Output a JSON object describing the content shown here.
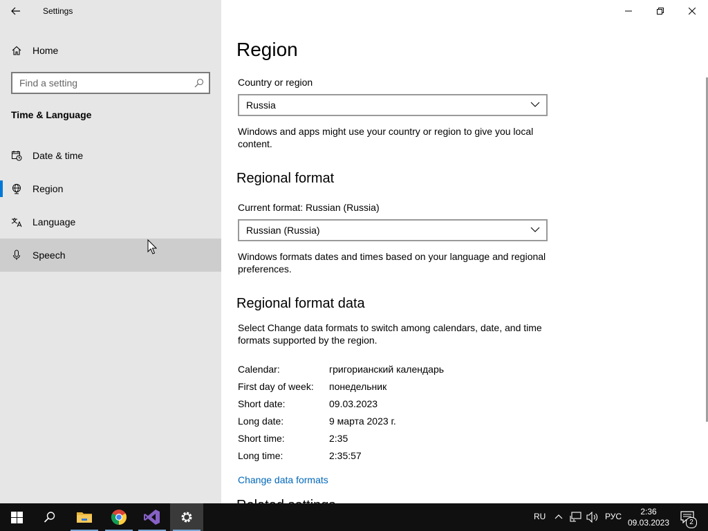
{
  "window": {
    "title": "Settings"
  },
  "sidebar": {
    "home_label": "Home",
    "search_placeholder": "Find a setting",
    "section_title": "Time & Language",
    "items": [
      {
        "label": "Date & time",
        "icon": "calendar-clock-icon"
      },
      {
        "label": "Region",
        "icon": "globe-icon",
        "selected": true
      },
      {
        "label": "Language",
        "icon": "language-icon"
      },
      {
        "label": "Speech",
        "icon": "microphone-icon",
        "hovered": true
      }
    ]
  },
  "main": {
    "title": "Region",
    "country": {
      "label": "Country or region",
      "value": "Russia",
      "description": "Windows and apps might use your country or region to give you local content."
    },
    "regional_format": {
      "heading": "Regional format",
      "label": "Current format: Russian (Russia)",
      "value": "Russian (Russia)",
      "description": "Windows formats dates and times based on your language and regional preferences."
    },
    "format_data": {
      "heading": "Regional format data",
      "description": "Select Change data formats to switch among calendars, date, and time formats supported by the region.",
      "rows": [
        {
          "key": "Calendar:",
          "value": "григорианский календарь"
        },
        {
          "key": "First day of week:",
          "value": "понедельник"
        },
        {
          "key": "Short date:",
          "value": "09.03.2023"
        },
        {
          "key": "Long date:",
          "value": "9 марта 2023 г."
        },
        {
          "key": "Short time:",
          "value": "2:35"
        },
        {
          "key": "Long time:",
          "value": "2:35:57"
        }
      ],
      "link": "Change data formats"
    },
    "related_heading": "Related settings"
  },
  "taskbar": {
    "lang_indicator": "RU",
    "input_lang": "РУС",
    "time": "2:36",
    "date": "09.03.2023",
    "notification_count": "2",
    "apps": [
      "start-icon",
      "search-icon",
      "file-explorer-icon",
      "chrome-icon",
      "visual-studio-icon",
      "settings-icon"
    ]
  },
  "colors": {
    "accent": "#0078d7",
    "link": "#0067b8",
    "sidebar_bg": "#e6e6e6",
    "taskbar_bg": "#101010"
  }
}
